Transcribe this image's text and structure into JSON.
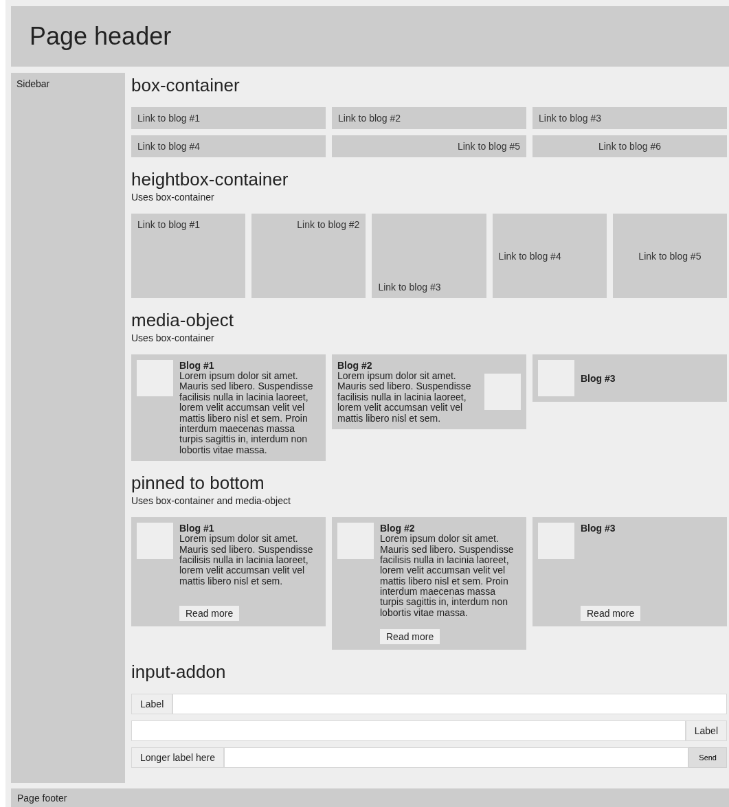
{
  "header": {
    "title": "Page header"
  },
  "sidebar": {
    "label": "Sidebar"
  },
  "box_container": {
    "title": "box-container",
    "links": [
      {
        "label": "Link to blog #1"
      },
      {
        "label": "Link to blog #2"
      },
      {
        "label": "Link to blog #3"
      },
      {
        "label": "Link to blog #4"
      },
      {
        "label": "Link to blog #5"
      },
      {
        "label": "Link to blog #6"
      }
    ]
  },
  "heightbox_container": {
    "title": "heightbox-container",
    "subtitle": "Uses box-container",
    "links": [
      {
        "label": "Link to blog #1"
      },
      {
        "label": "Link to blog #2"
      },
      {
        "label": "Link to blog #3"
      },
      {
        "label": "Link to blog #4"
      },
      {
        "label": "Link to blog #5"
      }
    ]
  },
  "media_object": {
    "title": "media-object",
    "subtitle": "Uses box-container",
    "cards": [
      {
        "title": "Blog #1",
        "text": "Lorem ipsum dolor sit amet. Mauris sed libero. Suspendisse facilisis nulla in lacinia laoreet, lorem velit accumsan velit vel mattis libero nisl et sem. Proin interdum maecenas massa turpis sagittis in, interdum non lobortis vitae massa."
      },
      {
        "title": "Blog #2",
        "text": "Lorem ipsum dolor sit amet. Mauris sed libero. Suspendisse facilisis nulla in lacinia laoreet, lorem velit accumsan velit vel mattis libero nisl et sem."
      },
      {
        "title": "Blog #3"
      }
    ]
  },
  "pinned_to_bottom": {
    "title": "pinned to bottom",
    "subtitle": "Uses box-container and media-object",
    "cards": [
      {
        "title": "Blog #1",
        "text": "Lorem ipsum dolor sit amet. Mauris sed libero. Suspendisse facilisis nulla in lacinia laoreet, lorem velit accumsan velit vel mattis libero nisl et sem.",
        "button": "Read more"
      },
      {
        "title": "Blog #2",
        "text": "Lorem ipsum dolor sit amet. Mauris sed libero. Suspendisse facilisis nulla in lacinia laoreet, lorem velit accumsan velit vel mattis libero nisl et sem. Proin interdum maecenas massa turpis sagittis in, interdum non lobortis vitae massa.",
        "button": "Read more"
      },
      {
        "title": "Blog #3",
        "button": "Read more"
      }
    ]
  },
  "input_addon": {
    "title": "input-addon",
    "rows": [
      {
        "kind": "label-left",
        "label": "Label"
      },
      {
        "kind": "label-right",
        "label": "Label"
      },
      {
        "kind": "label-left-button",
        "label": "Longer label here",
        "button": "Send"
      }
    ]
  },
  "footer": {
    "label": "Page footer"
  }
}
